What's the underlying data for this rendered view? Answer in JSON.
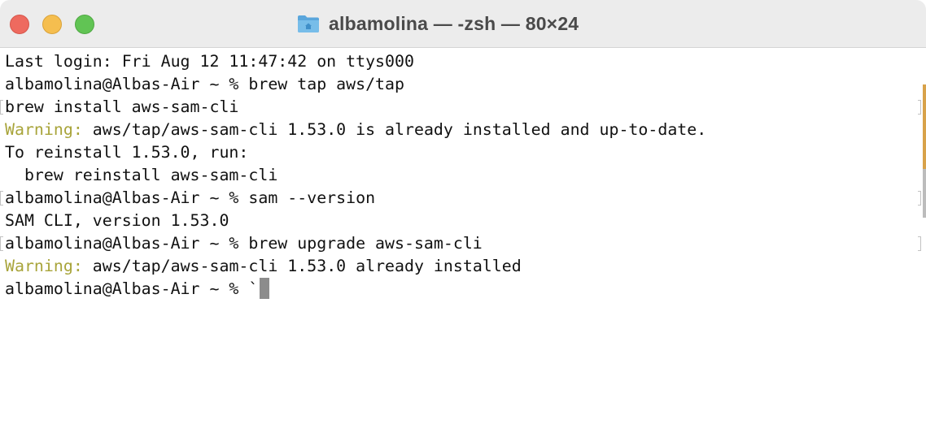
{
  "window": {
    "title": "albamolina — -zsh — 80×24"
  },
  "terminal": {
    "line1": "Last login: Fri Aug 12 11:47:42 on ttys000",
    "line2": "albamolina@Albas-Air ~ % brew tap aws/tap",
    "line3": "brew install aws-sam-cli",
    "line4_label": "Warning:",
    "line4_text": " aws/tap/aws-sam-cli 1.53.0 is already installed and up-to-date.",
    "line5": "To reinstall 1.53.0, run:",
    "line6": "  brew reinstall aws-sam-cli",
    "line7": "albamolina@Albas-Air ~ % sam --version",
    "line8": "SAM CLI, version 1.53.0",
    "line9": "albamolina@Albas-Air ~ % brew upgrade aws-sam-cli",
    "line10_label": "Warning:",
    "line10_text": " aws/tap/aws-sam-cli 1.53.0 already installed",
    "line11": "albamolina@Albas-Air ~ % `"
  },
  "colors": {
    "warning": "#a8a43a",
    "close": "#ee6a5f",
    "minimize": "#f5be4f",
    "maximize": "#61c454"
  }
}
